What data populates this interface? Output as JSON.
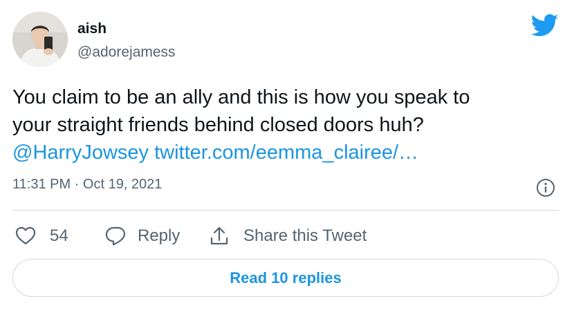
{
  "user": {
    "name": "aish",
    "handle": "@adorejamess"
  },
  "tweet": {
    "line1": "You claim to be an ally and this is how you speak to",
    "line2": "your straight friends behind closed doors huh?",
    "mention": "@HarryJowsey",
    "url": "twitter.com/eemma_clairee/…",
    "timestamp": "11:31 PM · Oct 19, 2021"
  },
  "actions": {
    "like_count": "54",
    "reply_label": "Reply",
    "share_label": "Share this Tweet"
  },
  "read_replies_label": "Read 10 replies",
  "colors": {
    "link": "#1b95e0",
    "text": "#0f1419",
    "secondary": "#536471",
    "border": "#cfd9de",
    "twitter_blue": "#1d9bf0"
  },
  "icons": {
    "brand": "twitter-bird-icon",
    "info": "info-icon",
    "like": "heart-icon",
    "reply": "speech-bubble-icon",
    "share": "share-upload-icon"
  }
}
